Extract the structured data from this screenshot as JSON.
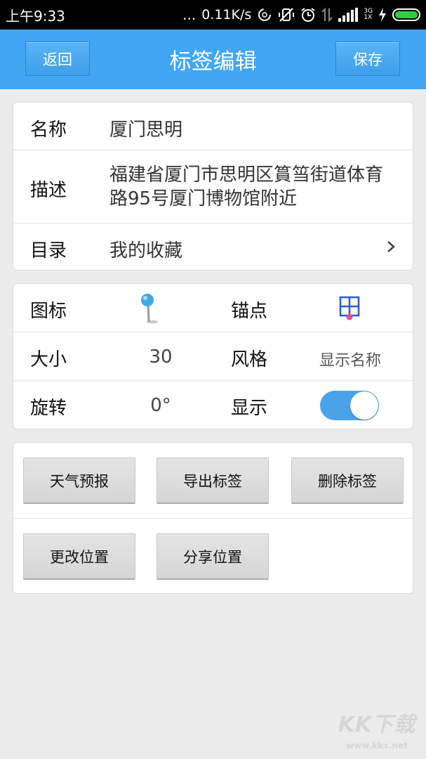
{
  "status_bar": {
    "time": "上午9:33",
    "dots": "...",
    "net_speed": "0.11K/s",
    "network_type_top": "3G",
    "network_type_bottom": "1X"
  },
  "header": {
    "back_label": "返回",
    "title": "标签编辑",
    "save_label": "保存"
  },
  "info": {
    "name_label": "名称",
    "name_value": "厦门思明",
    "desc_label": "描述",
    "desc_value": "福建省厦门市思明区篔筜街道体育路95号厦门博物馆附近",
    "dir_label": "目录",
    "dir_value": "我的收藏"
  },
  "style": {
    "icon_label": "图标",
    "anchor_label": "锚点",
    "size_label": "大小",
    "size_value": "30",
    "style_label": "风格",
    "style_value": "显示名称",
    "rotate_label": "旋转",
    "rotate_value": "0°",
    "display_label": "显示",
    "display_on": true
  },
  "actions": {
    "weather": "天气预报",
    "export": "导出标签",
    "delete": "删除标签",
    "change_position": "更改位置",
    "share_position": "分享位置"
  },
  "watermark": {
    "main": "KK下载",
    "sub": "www.kkx.net"
  },
  "colors": {
    "accent": "#41a6f4",
    "toggle_on": "#4aa3e8",
    "battery": "#2ecc40"
  }
}
